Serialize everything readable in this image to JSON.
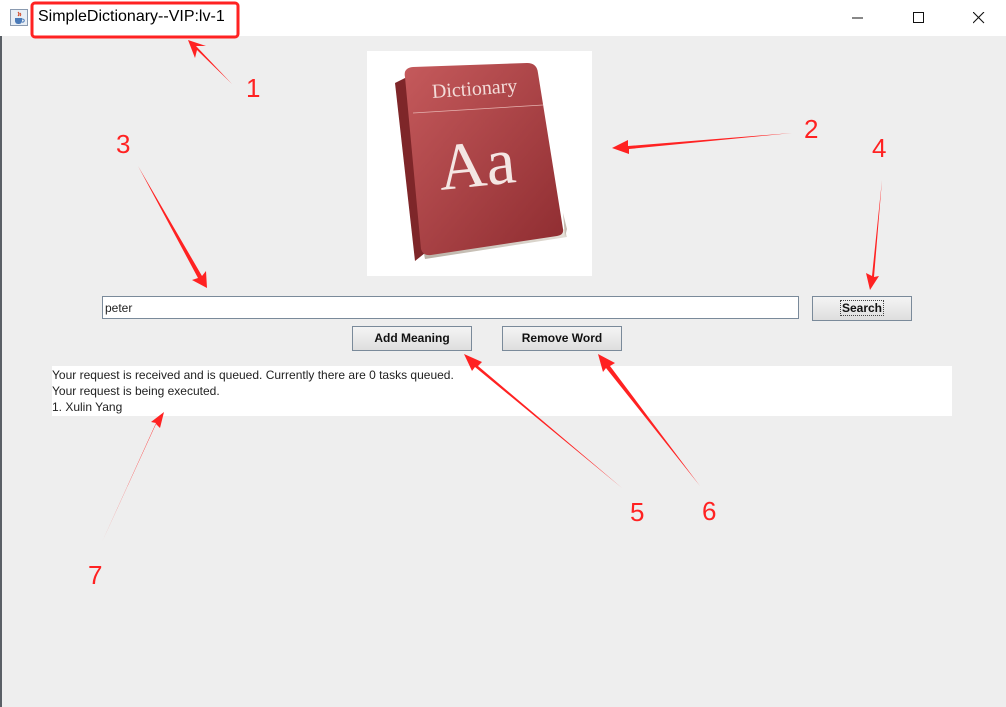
{
  "window": {
    "title": "SimpleDictionary--VIP:lv-1",
    "icon": "java-cup-icon",
    "controls": [
      "minimize-icon",
      "maximize-icon",
      "close-icon"
    ]
  },
  "logo": {
    "text": "Dictionary",
    "glyph": "Aa"
  },
  "search": {
    "value": "peter",
    "button_label": "Search"
  },
  "actions": {
    "add_label": "Add Meaning",
    "remove_label": "Remove Word"
  },
  "output": {
    "lines": [
      "Your request is received and is queued. Currently there are 0 tasks queued.",
      "Your request is being executed.",
      "1. Xulin Yang"
    ]
  },
  "annotations": {
    "color": "#ff2222",
    "labels": [
      "1",
      "2",
      "3",
      "4",
      "5",
      "6",
      "7"
    ]
  }
}
